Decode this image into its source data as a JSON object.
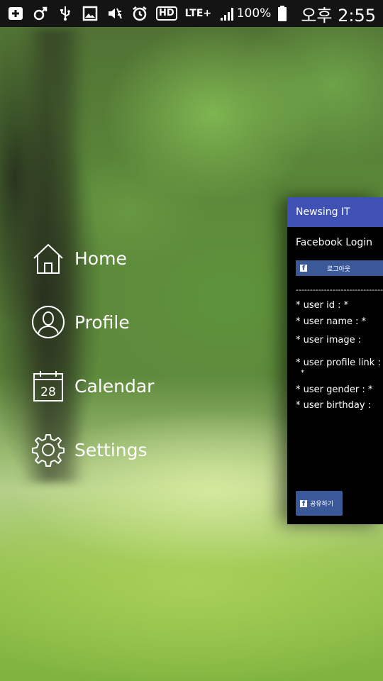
{
  "status_bar": {
    "icons": [
      "add-box-icon",
      "gender-symbol-icon",
      "usb-icon",
      "image-icon",
      "mute-icon",
      "alarm-icon",
      "hd-icon",
      "lte-icon",
      "signal-icon"
    ],
    "hd_label": "HD",
    "lte_label": "LTE+",
    "battery_text": "100%",
    "time": "오후 2:55"
  },
  "menu": {
    "items": [
      {
        "label": "Home",
        "icon": "home-icon"
      },
      {
        "label": "Profile",
        "icon": "profile-icon"
      },
      {
        "label": "Calendar",
        "icon": "calendar-icon",
        "calendar_day": "28"
      },
      {
        "label": "Settings",
        "icon": "settings-icon"
      }
    ]
  },
  "app_card": {
    "title": "Newsing IT",
    "fb_title": "Facebook Login",
    "logout_label": "로그아웃",
    "divider": "--------------------------------------",
    "info": {
      "user_id": "* user id      :  *",
      "user_name": "* user name :  *",
      "user_image": "* user image  :",
      "user_profile_link": "* user profile link  :",
      "user_profile_link_cont": "*",
      "user_gender": "* user gender   : *",
      "user_birthday": "* user birthday   :"
    },
    "share_label": "공유하기"
  },
  "colors": {
    "status_bar_bg": "#141414",
    "toolbar": "#3f51b5",
    "facebook": "#3b5998",
    "card_bg": "#000000"
  }
}
